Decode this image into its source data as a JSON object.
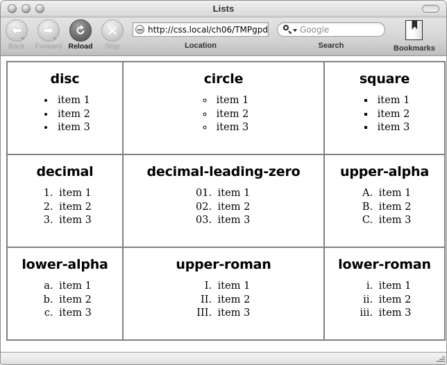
{
  "window": {
    "title": "Lists",
    "controls": [
      "close-button",
      "minimize-button",
      "zoom-button"
    ],
    "toolbar_toggle": "toolbar-toggle-pill"
  },
  "toolbar": {
    "buttons": [
      {
        "name": "back",
        "label": "Back",
        "enabled": false,
        "has_menu": true
      },
      {
        "name": "forward",
        "label": "Forward",
        "enabled": false,
        "has_menu": true
      },
      {
        "name": "reload",
        "label": "Reload",
        "enabled": true,
        "has_menu": false
      },
      {
        "name": "stop",
        "label": "Stop",
        "enabled": false,
        "has_menu": false
      }
    ],
    "location": {
      "caption": "Location",
      "url": "http://css.local/ch06/TMPgpd",
      "icon": "page-globe-icon"
    },
    "search": {
      "caption": "Search",
      "placeholder": "Google",
      "icon": "search-magnifier-icon"
    },
    "bookmarks": {
      "label": "Bookmarks",
      "icon": "bookmark-book-icon"
    }
  },
  "statusbar": {
    "text": "",
    "resize_grip": "resize-grip"
  },
  "content": {
    "table": [
      [
        {
          "title": "disc",
          "list_kind": "ul",
          "style_class": "disc",
          "marker_glyph": "•",
          "items": [
            "item 1",
            "item 2",
            "item 3"
          ]
        },
        {
          "title": "circle",
          "list_kind": "ul",
          "style_class": "circle",
          "marker_glyph": "◦",
          "items": [
            "item 1",
            "item 2",
            "item 3"
          ]
        },
        {
          "title": "square",
          "list_kind": "ul",
          "style_class": "square",
          "marker_glyph": "▪",
          "items": [
            "item 1",
            "item 2",
            "item 3"
          ]
        }
      ],
      [
        {
          "title": "decimal",
          "list_kind": "ol",
          "style_class": "decimal",
          "markers": [
            "1.",
            "2.",
            "3."
          ],
          "items": [
            "item 1",
            "item 2",
            "item 3"
          ]
        },
        {
          "title": "decimal-leading-zero",
          "list_kind": "ol",
          "style_class": "dlz",
          "markers": [
            "01.",
            "02.",
            "03."
          ],
          "items": [
            "item 1",
            "item 2",
            "item 3"
          ]
        },
        {
          "title": "upper-alpha",
          "list_kind": "ol",
          "style_class": "ualpha",
          "markers": [
            "A.",
            "B.",
            "C."
          ],
          "items": [
            "item 1",
            "item 2",
            "item 3"
          ]
        }
      ],
      [
        {
          "title": "lower-alpha",
          "list_kind": "ol",
          "style_class": "lalpha",
          "markers": [
            "a.",
            "b.",
            "c."
          ],
          "items": [
            "item 1",
            "item 2",
            "item 3"
          ]
        },
        {
          "title": "upper-roman",
          "list_kind": "ol",
          "style_class": "uroman",
          "markers": [
            "I.",
            "II.",
            "III."
          ],
          "items": [
            "item 1",
            "item 2",
            "item 3"
          ]
        },
        {
          "title": "lower-roman",
          "list_kind": "ol",
          "style_class": "lroman",
          "markers": [
            "i.",
            "ii.",
            "iii."
          ],
          "items": [
            "item 1",
            "item 2",
            "item 3"
          ]
        }
      ]
    ]
  },
  "colors": {
    "table_border": "#808080",
    "page_background": "#ffffff",
    "text": "#000000",
    "chrome_light": "#e4e4e4",
    "chrome_dark": "#bdbdbd"
  }
}
